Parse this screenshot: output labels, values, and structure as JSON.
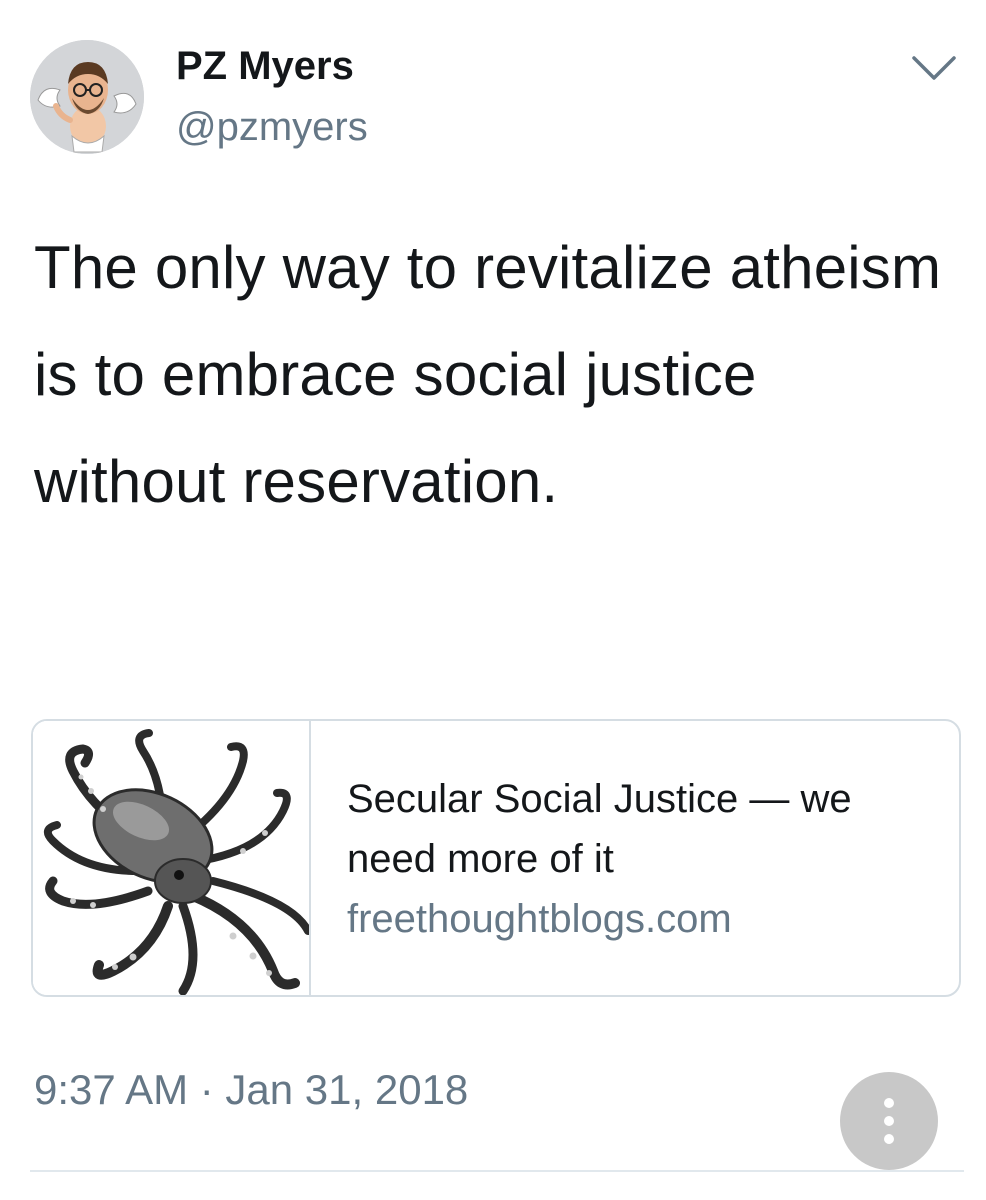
{
  "tweet": {
    "author": {
      "display_name": "PZ Myers",
      "handle": "@pzmyers",
      "avatar_icon": "avatar-cherub-icon"
    },
    "menu_icon": "chevron-down-icon",
    "text": "The only way to revitalize atheism is to embrace social justice without reservation.",
    "card": {
      "image_icon": "octopus-illustration",
      "title": "Secular Social Justice — we need more of it",
      "domain": "freethoughtblogs.com"
    },
    "timestamp": "9:37 AM · Jan 31, 2018",
    "more_icon": "vertical-ellipsis-icon"
  },
  "colors": {
    "text_primary": "#14171a",
    "text_secondary": "#657786",
    "card_border": "#d5dde3",
    "more_button_bg": "#c8c8c8"
  }
}
